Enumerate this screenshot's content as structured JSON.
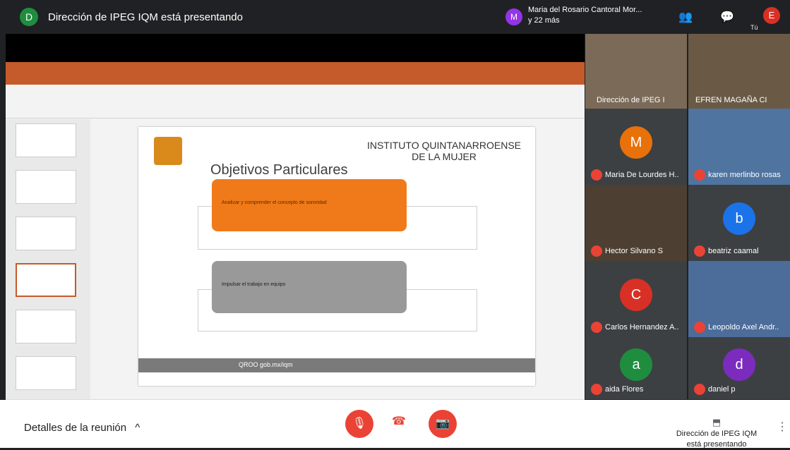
{
  "header": {
    "presenter_initial": "D",
    "presenting_text": "Dirección de IPEG IQM está presentando",
    "participants": {
      "initial": "M",
      "name": "Maria del Rosario Cantoral Mor...",
      "more": "y 22 más"
    },
    "you_initial": "E",
    "you_label": "Tú"
  },
  "presentation": {
    "org_title": "INSTITUTO QUINTANARROENSE DE LA MUJER",
    "slide_title": "Objetivos Particulares",
    "card1_text": "Analizar y comprender el concepto de sororidad",
    "card2_text": "Impulsar el trabajo en equipo",
    "footer_text": "QROO gob.mx/iqm"
  },
  "participants": [
    {
      "name": "Dirección de IPEG I",
      "initial": ""
    },
    {
      "name": "EFREN MAGAÑA CI",
      "initial": ""
    },
    {
      "name": "Maria De Lourdes H..",
      "initial": "M",
      "color": "#e8710a"
    },
    {
      "name": "karen merlinbo rosas",
      "initial": ""
    },
    {
      "name": "Hector Silvano S",
      "initial": ""
    },
    {
      "name": "beatriz caamal",
      "initial": "b",
      "color": "#1a73e8"
    },
    {
      "name": "Carlos Hernandez A..",
      "initial": "C",
      "color": "#d93025"
    },
    {
      "name": "Leopoldo Axel Andr..",
      "initial": ""
    },
    {
      "name": "aida Flores",
      "initial": "a",
      "color": "#1e8e3e"
    },
    {
      "name": "daniel p",
      "initial": "d",
      "color": "#7b2cbf"
    }
  ],
  "bottom": {
    "details_label": "Detalles de la reunión",
    "presenting_status": "Dirección de IPEG IQM está presentando"
  }
}
